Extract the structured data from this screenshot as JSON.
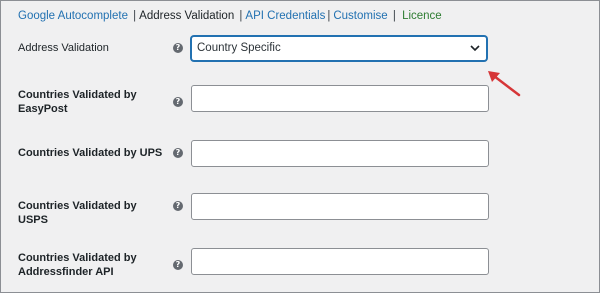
{
  "tabs": [
    {
      "label": "Google Autocomplete"
    },
    {
      "label": "Address Validation"
    },
    {
      "label": "API Credentials"
    },
    {
      "label": "Customise"
    },
    {
      "label": "Licence"
    }
  ],
  "separator": "|",
  "help_glyph": "?",
  "address_validation": {
    "label": "Address Validation",
    "selected": "Country Specific"
  },
  "fields": [
    {
      "label": "Countries Validated by EasyPost",
      "value": ""
    },
    {
      "label": "Countries Validated by UPS",
      "value": ""
    },
    {
      "label": "Countries Validated by USPS",
      "value": ""
    },
    {
      "label": "Countries Validated by Addressfinder API",
      "value": ""
    }
  ],
  "colors": {
    "link": "#2271b1",
    "licence": "#2e7d32",
    "annotation_arrow": "#d63638"
  },
  "icons": [
    "help-icon",
    "chevron-down-icon",
    "annotation-arrow-icon"
  ]
}
